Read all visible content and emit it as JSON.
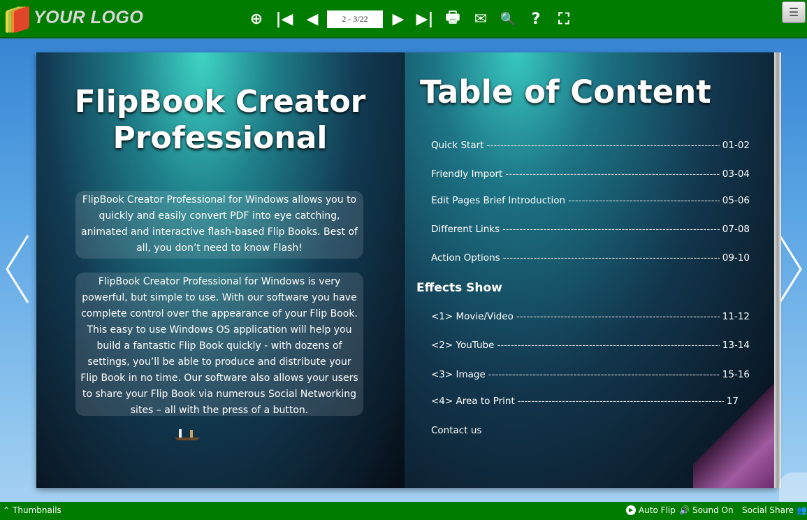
{
  "topbar": {
    "logo_text": "YOUR LOGO",
    "page_indicator": "2 - 3/22",
    "buttons": [
      {
        "name": "zoom-in",
        "glyph": "⊕"
      },
      {
        "name": "first-page",
        "glyph": "⏮"
      },
      {
        "name": "prev-page",
        "glyph": "◀"
      },
      {
        "name": "next-page",
        "glyph": "▶"
      },
      {
        "name": "last-page",
        "glyph": "⏭"
      },
      {
        "name": "print",
        "glyph": "🖶"
      },
      {
        "name": "email",
        "glyph": "✉"
      },
      {
        "name": "search",
        "glyph": "🔍"
      },
      {
        "name": "help",
        "glyph": "?"
      },
      {
        "name": "fullscreen",
        "glyph": "⛶"
      }
    ],
    "menu_glyph": "☰",
    "accent": "#007d00"
  },
  "left_page": {
    "title_line1": "FlipBook Creator",
    "title_line2": "Professional",
    "para1": "FlipBook Creator Professional for Windows allows you to quickly and easily convert PDF into eye catching, animated and interactive flash-based Flip Books. Best of all, you don’t need to know Flash!",
    "para2": "FlipBook Creator Professional for Windows is very powerful, but simple to use. With our software you have complete control over the appearance of your Flip Book. This easy to use Windows OS application will help you build a fantastic Flip Book quickly - with dozens of settings, you’ll be able to produce and distribute your Flip Book in no time. Our software also allows your users to share your Flip Book via numerous Social Networking sites – all with the press of a button."
  },
  "right_page": {
    "title": "Table of Content",
    "effects_heading": "Effects Show",
    "entries": [
      {
        "label": "Quick Start",
        "pages": "01-02"
      },
      {
        "label": "Friendly Import",
        "pages": "03-04"
      },
      {
        "label": "Edit Pages Brief Introduction",
        "pages": "05-06"
      },
      {
        "label": "Different Links",
        "pages": "07-08"
      },
      {
        "label": "Action Options",
        "pages": "09-10"
      }
    ],
    "effects": [
      {
        "label": "<1> Movie/Video",
        "pages": "11-12"
      },
      {
        "label": "<2> YouTube",
        "pages": "13-14"
      },
      {
        "label": "<3> Image",
        "pages": "15-16"
      },
      {
        "label": "<4> Area to Print",
        "pages": "17"
      }
    ],
    "contact": "Contact us"
  },
  "bottombar": {
    "thumbnails": "Thumbnails",
    "auto_flip": "Auto Flip",
    "sound": "Sound On",
    "social_share": "Social Share"
  }
}
